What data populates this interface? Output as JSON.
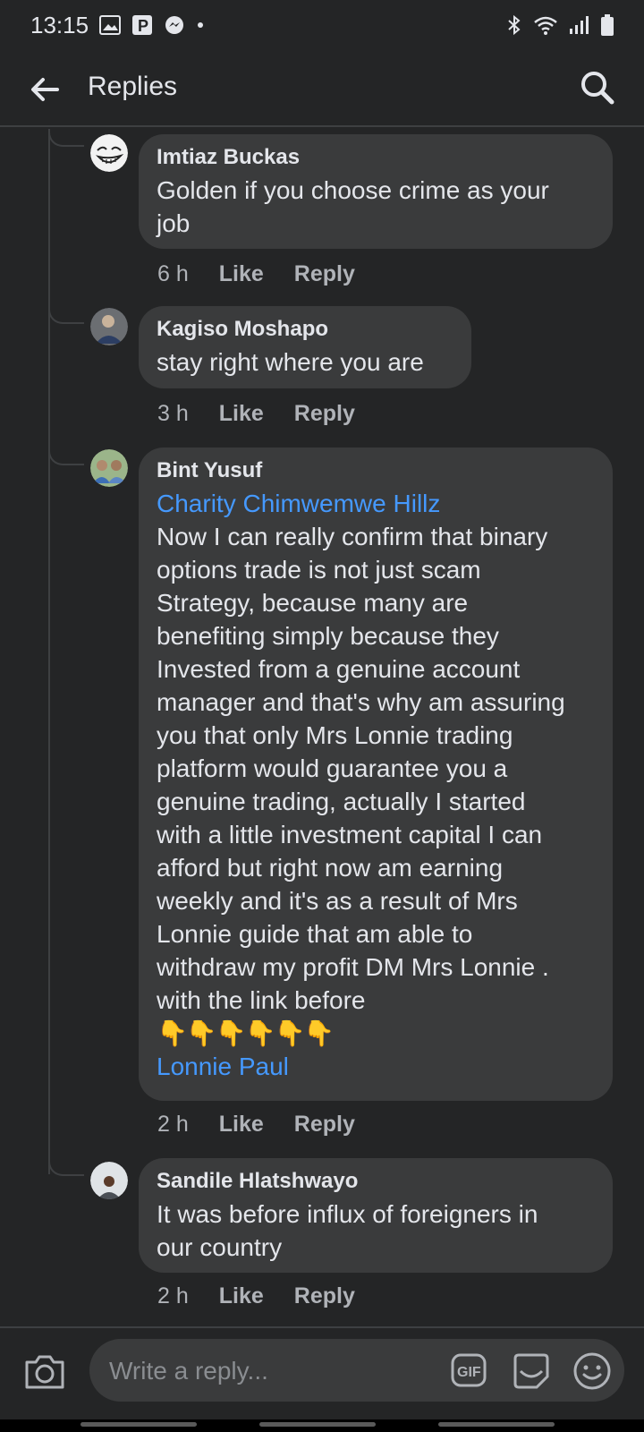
{
  "status_bar": {
    "time": "13:15",
    "left_icons": [
      "image-icon",
      "parking-p-icon",
      "messenger-icon",
      "dot-icon"
    ],
    "right_icons": [
      "bluetooth-icon",
      "wifi-icon",
      "signal-icon",
      "battery-icon"
    ]
  },
  "header": {
    "title": "Replies",
    "back_icon": "arrow-left-icon",
    "search_icon": "search-icon"
  },
  "replies": [
    {
      "author": "Imtiaz Buckas",
      "mention": "",
      "text": "Golden if you choose crime as your\njob",
      "time": "6 h",
      "like": "Like",
      "reply": "Reply"
    },
    {
      "author": "Kagiso Moshapo",
      "mention": "",
      "text": "stay right where you are",
      "time": "3 h",
      "like": "Like",
      "reply": "Reply"
    },
    {
      "author": "Bint Yusuf",
      "mention": "Charity Chimwemwe Hillz",
      "text": "Now I can really confirm that binary\noptions trade is not just scam\nStrategy, because many are\nbenefiting simply because they\nInvested from a genuine account\nmanager and that's why am assuring\nyou that only Mrs Lonnie trading\nplatform would guarantee you a\ngenuine trading, actually I started\nwith a little investment capital I can\nafford but right now am earning\nweekly and it's as a result of Mrs\nLonnie guide that am able to\nwithdraw my profit DM Mrs Lonnie .\nwith the link before",
      "emojis": "👇👇👇👇👇👇",
      "trailing_mention": "Lonnie Paul",
      "time": "2 h",
      "like": "Like",
      "reply": "Reply"
    },
    {
      "author": "Sandile Hlatshwayo",
      "mention": "",
      "text": "It was before influx of foreigners in\nour country",
      "time": "2 h",
      "like": "Like",
      "reply": "Reply"
    }
  ],
  "composer": {
    "placeholder": "Write a reply...",
    "camera_icon": "camera-icon",
    "gif_label": "GIF",
    "sticker_icon": "sticker-icon",
    "emoji_icon": "smiley-icon"
  },
  "colors": {
    "background": "#242526",
    "bubble": "#3a3b3c",
    "text": "#e4e6eb",
    "secondary_text": "#b0b3b8",
    "mention": "#4599ff"
  }
}
